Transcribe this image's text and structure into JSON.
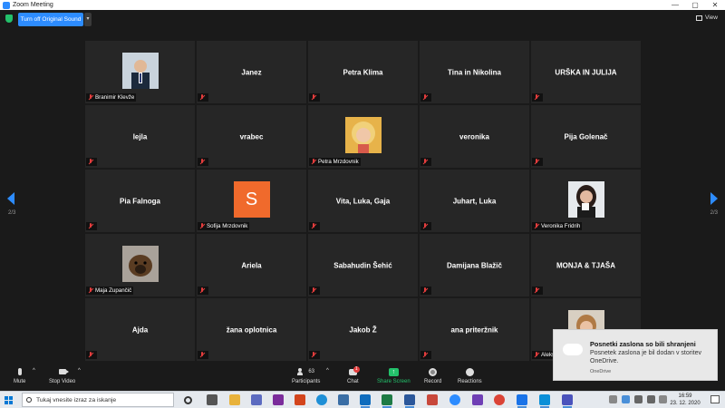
{
  "window": {
    "title": "Zoom Meeting",
    "controls": [
      "—",
      "▢",
      "✕"
    ]
  },
  "topbar": {
    "original_sound_label": "Turn off Original Sound",
    "caret": "▾",
    "view_label": "View"
  },
  "pagination": {
    "left": "2/3",
    "right": "2/3"
  },
  "tiles": [
    {
      "name": "",
      "label": "Branimir Klevže",
      "kind": "photo",
      "photo": "man-in-suit"
    },
    {
      "name": "Janez",
      "label": "",
      "kind": "text"
    },
    {
      "name": "Petra Klima",
      "label": "",
      "kind": "text"
    },
    {
      "name": "Tina in Nikolina",
      "label": "",
      "kind": "text"
    },
    {
      "name": "URŠKA IN JULIJA",
      "label": "",
      "kind": "text"
    },
    {
      "name": "lejla",
      "label": "",
      "kind": "text"
    },
    {
      "name": "vrabec",
      "label": "",
      "kind": "text"
    },
    {
      "name": "",
      "label": "Petra Mrzdovnik",
      "kind": "photo",
      "photo": "blonde-woman"
    },
    {
      "name": "veronika",
      "label": "",
      "kind": "text"
    },
    {
      "name": "Pija Golenač",
      "label": "",
      "kind": "text"
    },
    {
      "name": "Pia Falnoga",
      "label": "",
      "kind": "text"
    },
    {
      "name": "",
      "label": "Sofija Mrzdovnik",
      "kind": "letter",
      "letter": "S"
    },
    {
      "name": "Vita, Luka, Gaja",
      "label": "",
      "kind": "text"
    },
    {
      "name": "Juhart, Luka",
      "label": "",
      "kind": "text"
    },
    {
      "name": "",
      "label": "Veronika Fridrih",
      "kind": "photo",
      "photo": "woman-with-cup"
    },
    {
      "name": "",
      "label": "Maja Zupančič",
      "kind": "photo",
      "photo": "dog"
    },
    {
      "name": "Ariela",
      "label": "",
      "kind": "text"
    },
    {
      "name": "Sabahudin Šehić",
      "label": "",
      "kind": "text"
    },
    {
      "name": "Damijana Blažič",
      "label": "",
      "kind": "text"
    },
    {
      "name": "MONJA & TJAŠA",
      "label": "",
      "kind": "text"
    },
    {
      "name": "Ajda",
      "label": "",
      "kind": "text"
    },
    {
      "name": "žana oplotnica",
      "label": "",
      "kind": "text"
    },
    {
      "name": "Jakob Ž",
      "label": "",
      "kind": "text"
    },
    {
      "name": "ana priteržnik",
      "label": "",
      "kind": "text"
    },
    {
      "name": "",
      "label": "Aleksa",
      "kind": "photo",
      "photo": "woman-portrait"
    }
  ],
  "toolbar": {
    "mute": "Mute",
    "stop_video": "Stop Video",
    "participants": "Participants",
    "participants_count": "63",
    "chat": "Chat",
    "chat_badge": "1",
    "share_screen": "Share Screen",
    "record": "Record",
    "reactions": "Reactions",
    "caret": "^"
  },
  "notification": {
    "title": "Posnetki zaslona so bili shranjeni",
    "body": "Posnetek zaslona je bil dodan v storitev OneDrive.",
    "source": "OneDrive"
  },
  "taskbar": {
    "search_placeholder": "Tukaj vnesite izraz za iskanje",
    "time": "16:59",
    "date": "23. 12. 2020"
  },
  "colors": {
    "accent": "#2d8cff",
    "share": "#23c16b",
    "muted": "#e43d3d",
    "tile": "#262626"
  }
}
